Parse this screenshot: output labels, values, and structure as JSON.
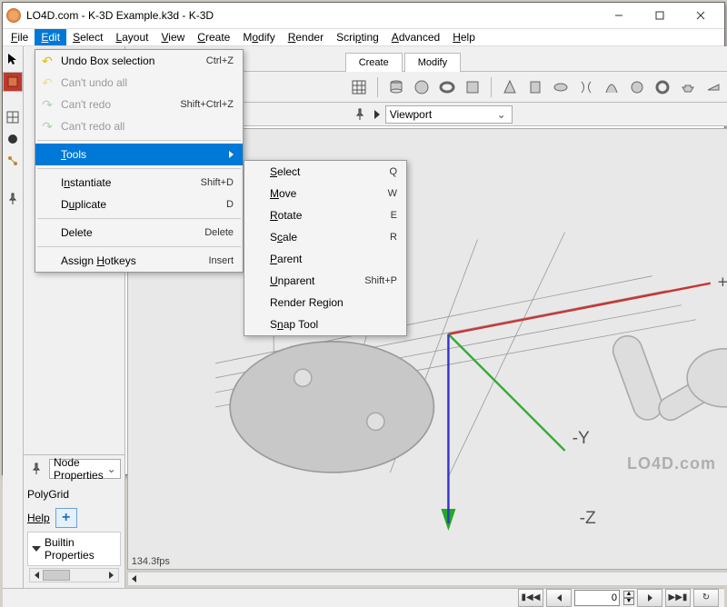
{
  "window": {
    "title": "LO4D.com - K-3D Example.k3d - K-3D"
  },
  "menubar": [
    "File",
    "Edit",
    "Select",
    "Layout",
    "View",
    "Create",
    "Modify",
    "Render",
    "Scripting",
    "Advanced",
    "Help"
  ],
  "edit_menu": {
    "undo": {
      "label": "Undo Box selection",
      "shortcut": "Ctrl+Z"
    },
    "undo_all": {
      "label": "Can't undo all"
    },
    "redo": {
      "label": "Can't redo",
      "shortcut": "Shift+Ctrl+Z"
    },
    "redo_all": {
      "label": "Can't redo all"
    },
    "tools": {
      "label": "Tools"
    },
    "instantiate": {
      "label": "Instantiate",
      "shortcut": "Shift+D"
    },
    "duplicate": {
      "label": "Duplicate",
      "shortcut": "D"
    },
    "delete": {
      "label": "Delete",
      "shortcut": "Delete"
    },
    "hotkeys": {
      "label": "Assign Hotkeys",
      "shortcut": "Insert"
    }
  },
  "tools_menu": {
    "select": {
      "label": "Select",
      "shortcut": "Q"
    },
    "move": {
      "label": "Move",
      "shortcut": "W"
    },
    "rotate": {
      "label": "Rotate",
      "shortcut": "E"
    },
    "scale": {
      "label": "Scale",
      "shortcut": "R"
    },
    "parent": {
      "label": "Parent"
    },
    "unparent": {
      "label": "Unparent",
      "shortcut": "Shift+P"
    },
    "render_region": {
      "label": "Render Region"
    },
    "snap": {
      "label": "Snap Tool"
    }
  },
  "tabs": {
    "create": "Create",
    "modify": "Modify"
  },
  "viewport": {
    "label": "Viewport",
    "fps": "134.3fps",
    "axes": {
      "x": "+X",
      "y": "-Y",
      "z": "-Z"
    }
  },
  "left_panel": {
    "combo": "Node Properties",
    "object": "PolyGrid",
    "help": "Help",
    "section": "Builtin Properties"
  },
  "statusbar": {
    "value": "0"
  },
  "watermark": "LO4D.com"
}
